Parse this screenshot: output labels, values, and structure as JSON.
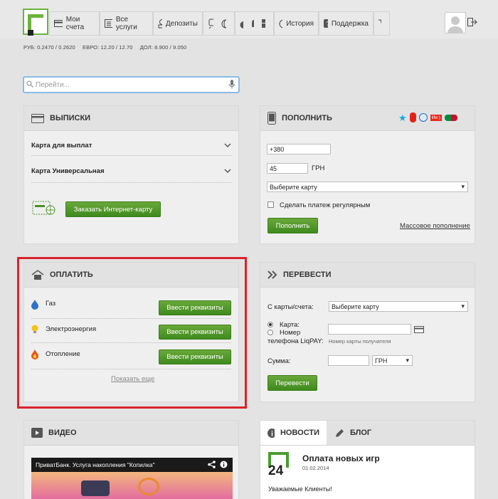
{
  "nav": {
    "accounts": "Мои счета",
    "services": "Все услуги",
    "deposits": "Депозиты",
    "history": "История",
    "support": "Поддержка"
  },
  "rates": {
    "rub": "РУБ:  0.2470 / 0.2620",
    "eur": "ЕВРО:  12.20 / 12.70",
    "usd": "ДОЛ:  8.900 / 9.050"
  },
  "search": {
    "placeholder": "Перейти..."
  },
  "statements": {
    "title": "ВЫПИСКИ",
    "cards": [
      "Карта для выплат",
      "Карта Универсальная"
    ],
    "order_button": "Заказать Интернет-карту"
  },
  "topup": {
    "title": "ПОПОЛНИТЬ",
    "phone_value": "+380",
    "amount_value": "45",
    "currency": "ГРН",
    "card_select": "Выберите карту",
    "regular_label": "Сделать платеж регулярным",
    "submit": "Пополнить",
    "mass_link": "Массовое пополнение",
    "operator_life": "life:)"
  },
  "pay": {
    "title": "ОПЛАТИТЬ",
    "items": [
      {
        "label": "Газ",
        "button": "Ввести реквизиты"
      },
      {
        "label": "Электроэнергия",
        "button": "Ввести реквизиты"
      },
      {
        "label": "Отопление",
        "button": "Ввести реквизиты"
      }
    ],
    "more": "Показать еще"
  },
  "transfer": {
    "title": "ПЕРЕВЕСТИ",
    "from_label": "С карты/счета:",
    "from_select": "Выберите карту",
    "opt_card": "Карта:",
    "opt_phone": "Номер",
    "opt_phone2": "телефона LiqPAY:",
    "hint": "Номер карты получателя",
    "sum_label": "Сумма:",
    "currency": "ГРН",
    "submit": "Перевести"
  },
  "video": {
    "title": "ВИДЕО",
    "caption": "ПриватБанк. Услуга накопления \"Копилка\""
  },
  "news": {
    "tab_news": "НОВОСТИ",
    "tab_blog": "БЛОГ",
    "headline": "Оплата новых игр",
    "date": "01.02.2014",
    "greeting": "Уважаемые Клиенты!",
    "logo_num": "24"
  },
  "colors": {
    "accent": "#6db33f",
    "button": "#4a9127",
    "highlight": "#d9232d"
  }
}
